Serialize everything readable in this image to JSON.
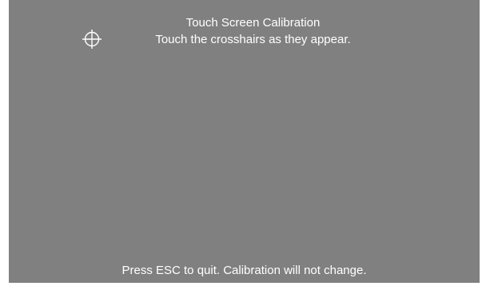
{
  "calibration": {
    "title": "Touch Screen Calibration",
    "instruction": "Touch the crosshairs as they appear.",
    "target_icon": "crosshair-icon",
    "footer": "Press ESC to quit.  Calibration will not change."
  },
  "colors": {
    "background": "#808080",
    "text": "#ffffff"
  }
}
